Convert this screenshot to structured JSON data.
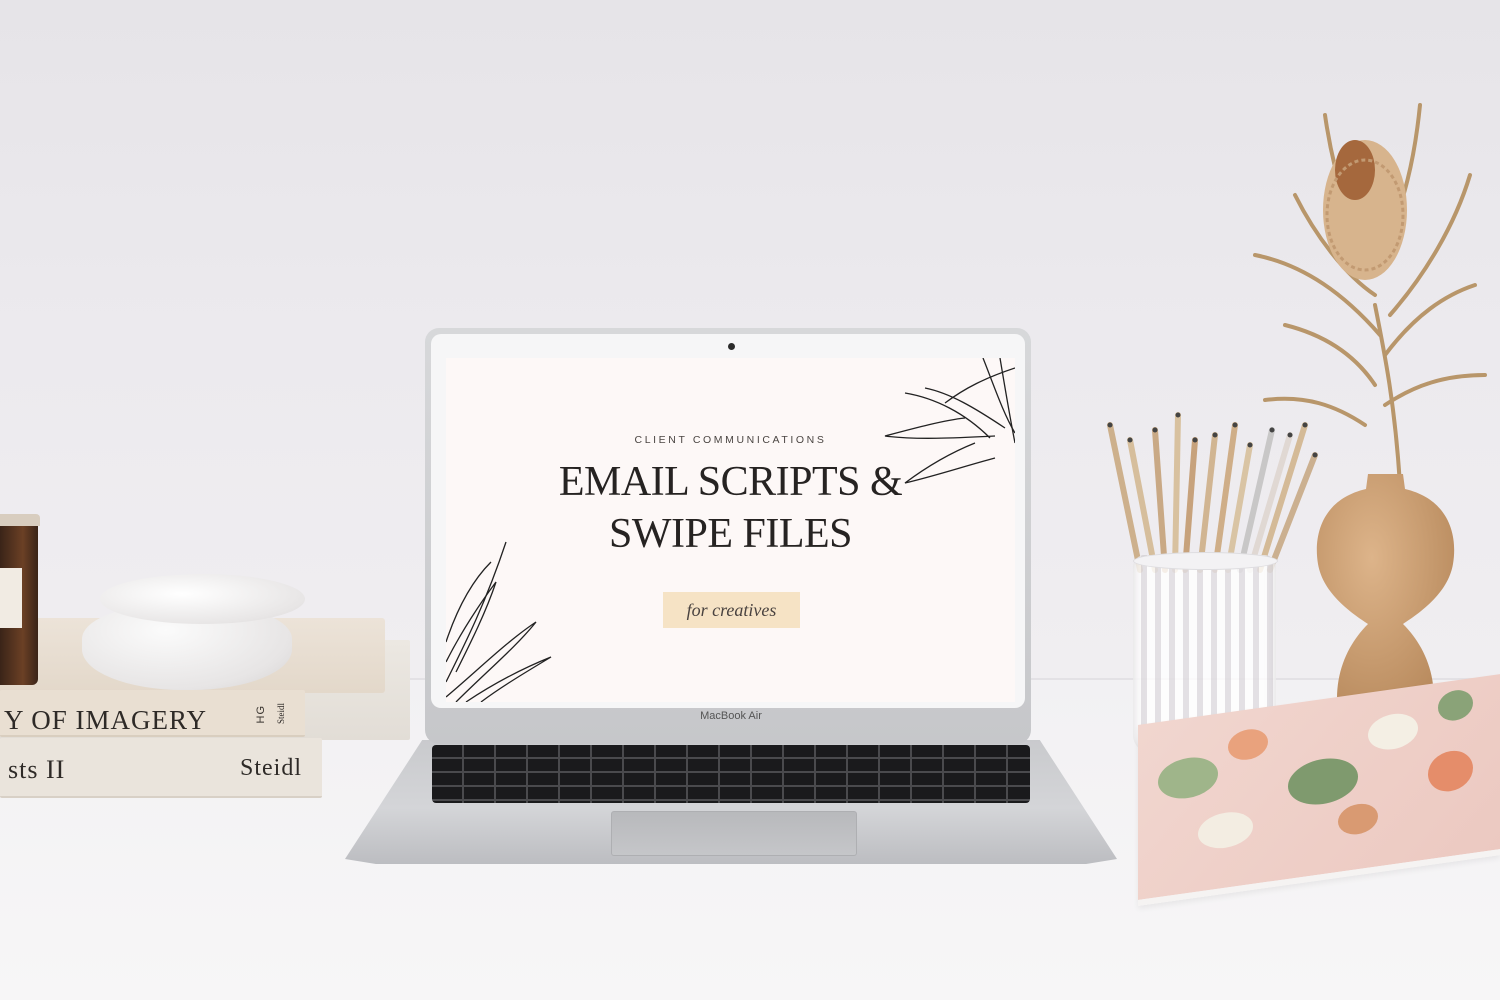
{
  "scene": {
    "description_alt": "",
    "books": {
      "top_title": "Y OF IMAGERY",
      "top_publisher": "Steidl",
      "top_logo": "HG",
      "bottom_title": "sts II",
      "bottom_publisher": "Steidl"
    }
  },
  "laptop": {
    "brand_label": "MacBook Air",
    "screen": {
      "kicker": "CLIENT COMMUNICATIONS",
      "title_line1": "EMAIL SCRIPTS &",
      "title_line2": "SWIPE FILES",
      "tag": "for creatives",
      "tag_color": "#f6e3c5",
      "background_color": "#fdf8f7"
    }
  },
  "colors": {
    "wall": "#ebe9ec",
    "desk": "#f4f3f4",
    "vase": "#c99b6c",
    "notebook": "#efd0c8"
  }
}
